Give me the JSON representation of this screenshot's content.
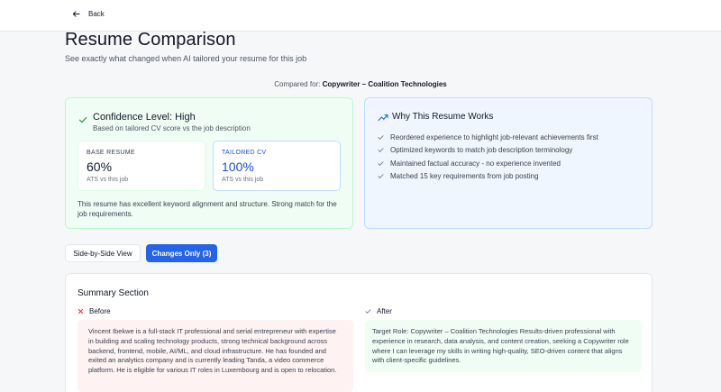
{
  "nav": {
    "back_label": "Back"
  },
  "header": {
    "title": "Resume Comparison",
    "subtitle": "See exactly what changed when AI tailored your resume for this job",
    "compared_prefix": "Compared for:",
    "compared_job": "Copywriter – Coalition Technologies"
  },
  "confidence": {
    "title": "Confidence Level: High",
    "subtitle": "Based on tailored CV score vs the job description",
    "base": {
      "label": "BASE RESUME",
      "value": "60%",
      "note": "ATS vs this job"
    },
    "tailored": {
      "label": "TAILORED CV",
      "value": "100%",
      "note": "ATS vs this job"
    },
    "description": "This resume has excellent keyword alignment and structure. Strong match for the job requirements.",
    "icon": "check-icon"
  },
  "why": {
    "title": "Why This Resume Works",
    "icon": "trending-up-icon",
    "items": [
      "Reordered experience to highlight job-relevant achievements first",
      "Optimized keywords to match job description terminology",
      "Maintained factual accuracy - no experience invented",
      "Matched 15 key requirements from job posting"
    ]
  },
  "view_toggle": {
    "side_by_side": "Side-by-Side View",
    "changes_only": "Changes Only (3)"
  },
  "summary": {
    "title": "Summary Section",
    "before_label": "Before",
    "after_label": "After",
    "before_text": "Vincent Ibekwe is a full-stack IT professional and serial entrepreneur with expertise in building and scaling technology products, strong technical background across backend, frontend, mobile, AI/ML, and cloud infrastructure. He has founded and exited an analytics company and is currently leading Tanda, a video commerce platform. He is eligible for various IT roles in Luxembourg and is open to relocation.",
    "after_text": "Target Role: Copywriter – Coalition Technologies Results-driven professional with experience in research, data analysis, and content creation, seeking a Copywriter role where I can leverage my skills in writing high-quality, SEO-driven content that aligns with client-specific guidelines."
  },
  "colors": {
    "accent": "#2563eb",
    "success_bg": "#f0fdf4",
    "info_bg": "#eff6ff",
    "before_bg": "#fef2f2",
    "before_icon": "#dc2626",
    "check": "#16a34a"
  }
}
